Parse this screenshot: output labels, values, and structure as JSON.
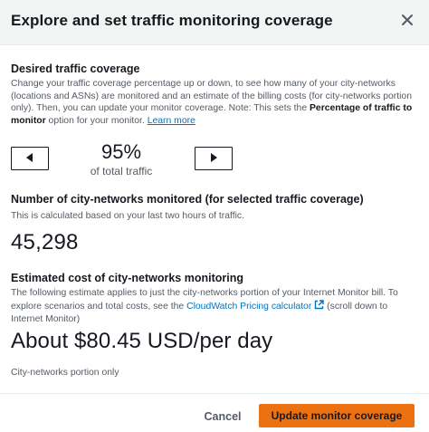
{
  "header": {
    "title": "Explore and set traffic monitoring coverage",
    "close_icon": "close-icon"
  },
  "coverage": {
    "title": "Desired traffic coverage",
    "desc_part1": "Change your traffic coverage percentage up or down, to see how many of your city-networks (locations and ASNs) are monitored and an estimate of the billing costs (for city-networks portion only). Then, you can update your monitor coverage. Note: This sets the ",
    "desc_bold": "Percentage of traffic to monitor",
    "desc_part2": " option for your monitor. ",
    "learn_more": "Learn more",
    "decrease_icon": "caret-left-icon",
    "increase_icon": "caret-right-icon",
    "percent_value": "95%",
    "percent_label": "of total traffic"
  },
  "cities": {
    "title": "Number of city-networks monitored (for selected traffic coverage)",
    "desc": "This is calculated based on your last two hours of traffic.",
    "value": "45,298"
  },
  "cost": {
    "title": "Estimated cost of city-networks monitoring",
    "desc_part1": "The following estimate applies to just the city-networks portion of your Internet Monitor bill. To explore scenarios and total costs, see the ",
    "pricing_link": "CloudWatch Pricing calculator",
    "external_icon": "external-link-icon",
    "desc_part2": " (scroll down to Internet Monitor)",
    "value": "About $80.45 USD/per day",
    "footnote": "City-networks portion only"
  },
  "footer": {
    "cancel_label": "Cancel",
    "update_label": "Update monitor coverage"
  },
  "colors": {
    "primary": "#ec7211",
    "link": "#0073bb",
    "header_bg": "#f2f3f3"
  }
}
